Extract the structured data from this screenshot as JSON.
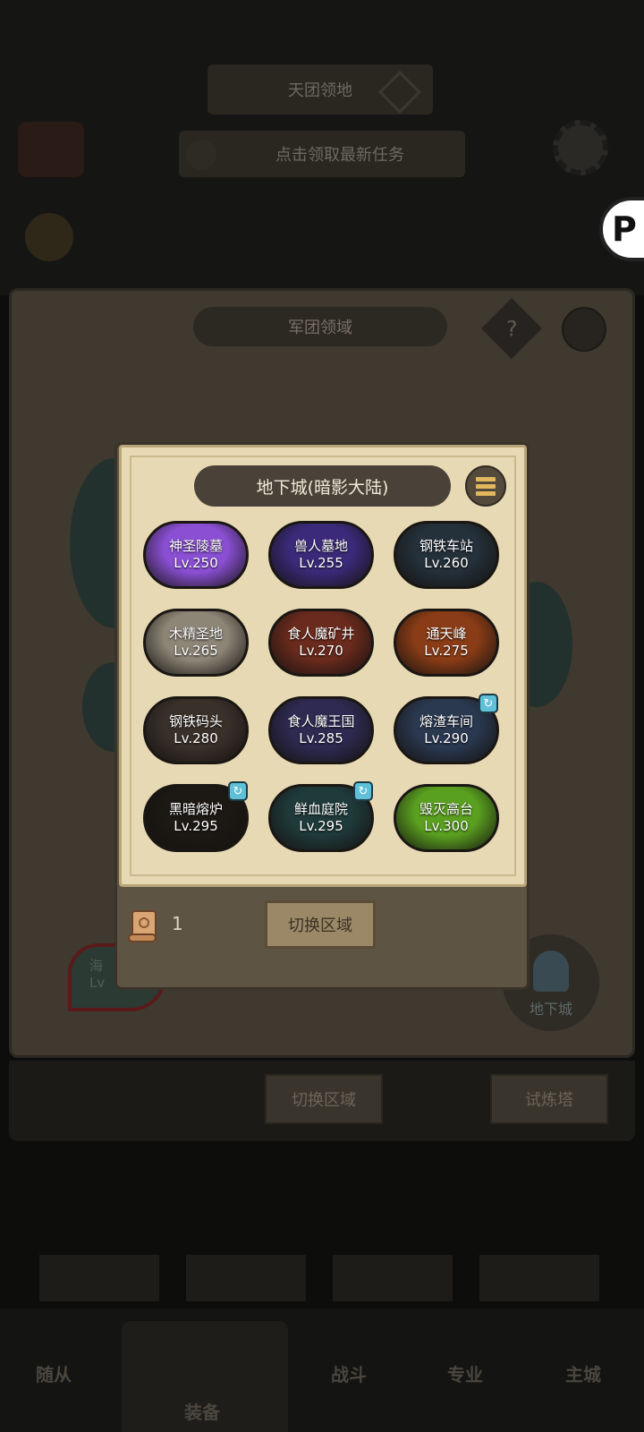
{
  "background": {
    "top_banner": "天团领地",
    "task_banner": "点击领取最新任务",
    "legion_title": "军团领域",
    "help_symbol": "?",
    "dungeon_node_label": "地下城",
    "sea_node_label": "海",
    "sea_node_level": "Lv",
    "switch_button": "切换区域",
    "trial_tower_button": "试炼塔",
    "bottom_tabs": [
      "随从",
      "装备",
      "战斗",
      "专业",
      "主城"
    ]
  },
  "modal": {
    "title": "地下城(暗影大陆)",
    "dungeons": [
      {
        "name": "神圣陵墓",
        "level": "Lv.250",
        "color": "#8a4fd3",
        "badge": false
      },
      {
        "name": "兽人墓地",
        "level": "Lv.255",
        "color": "#3b2a7a",
        "badge": false
      },
      {
        "name": "钢铁车站",
        "level": "Lv.260",
        "color": "#24303a",
        "badge": false
      },
      {
        "name": "木精圣地",
        "level": "Lv.265",
        "color": "#8d8576",
        "badge": false
      },
      {
        "name": "食人魔矿井",
        "level": "Lv.270",
        "color": "#6a2a1d",
        "badge": false
      },
      {
        "name": "通天峰",
        "level": "Lv.275",
        "color": "#8a3c16",
        "badge": false
      },
      {
        "name": "钢铁码头",
        "level": "Lv.280",
        "color": "#3a302a",
        "badge": false
      },
      {
        "name": "食人魔王国",
        "level": "Lv.285",
        "color": "#2e2a52",
        "badge": false
      },
      {
        "name": "熔渣车间",
        "level": "Lv.290",
        "color": "#2a3850",
        "badge": true
      },
      {
        "name": "黑暗熔炉",
        "level": "Lv.295",
        "color": "#1c1814",
        "badge": true
      },
      {
        "name": "鲜血庭院",
        "level": "Lv.295",
        "color": "#1f3a3a",
        "badge": true
      },
      {
        "name": "毁灭高台",
        "level": "Lv.300",
        "color": "#5aa020",
        "badge": false
      }
    ],
    "scroll_count": "1",
    "switch_area_button": "切换区域"
  }
}
